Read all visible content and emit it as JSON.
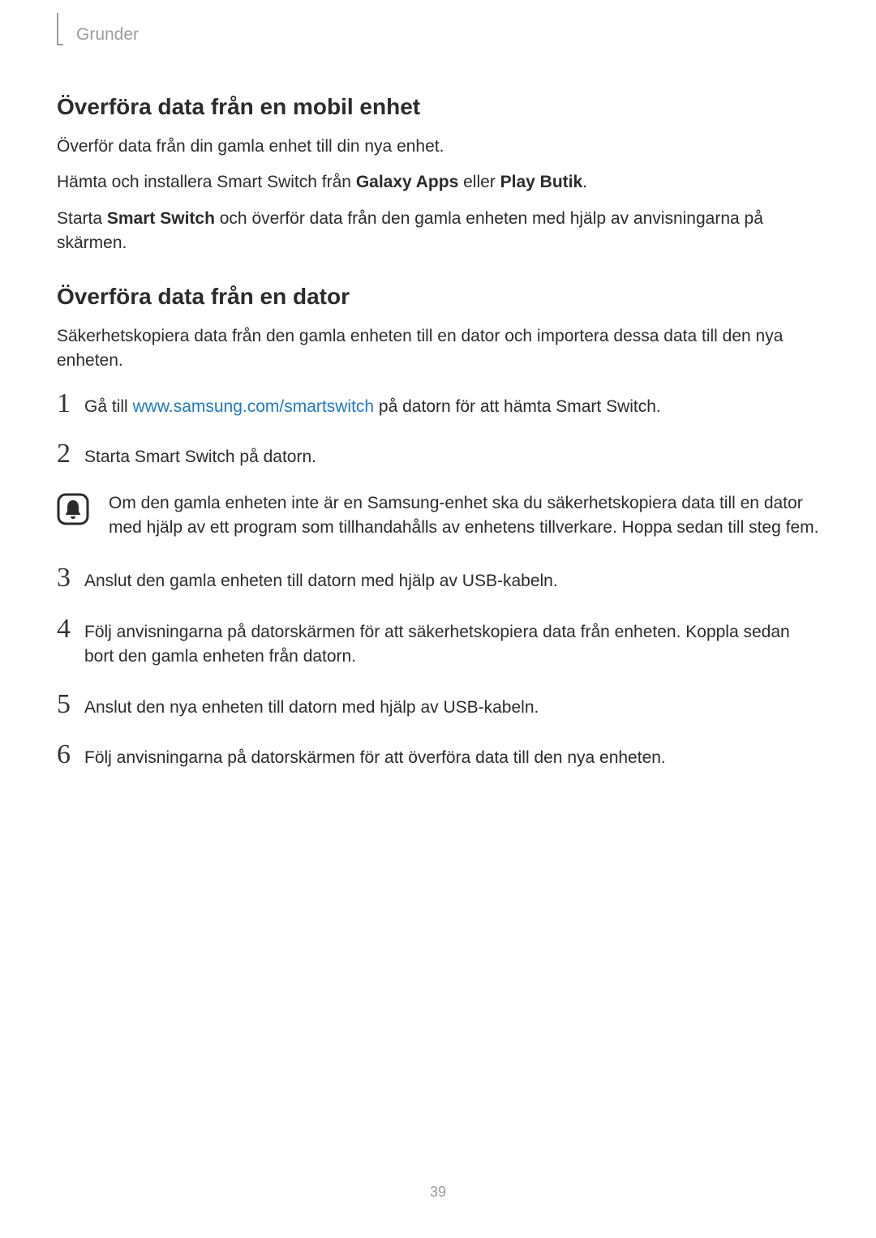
{
  "header": {
    "breadcrumb": "Grunder"
  },
  "section1": {
    "heading": "Överföra data från en mobil enhet",
    "p1": "Överför data från din gamla enhet till din nya enhet.",
    "p2_a": "Hämta och installera Smart Switch från ",
    "p2_b": "Galaxy Apps",
    "p2_c": " eller ",
    "p2_d": "Play Butik",
    "p2_e": ".",
    "p3_a": "Starta ",
    "p3_b": "Smart Switch",
    "p3_c": " och överför data från den gamla enheten med hjälp av anvisningarna på skärmen."
  },
  "section2": {
    "heading": "Överföra data från en dator",
    "intro": "Säkerhetskopiera data från den gamla enheten till en dator och importera dessa data till den nya enheten.",
    "steps": {
      "s1_a": "Gå till ",
      "s1_link": "www.samsung.com/smartswitch",
      "s1_b": " på datorn för att hämta Smart Switch.",
      "s2": "Starta Smart Switch på datorn.",
      "note": "Om den gamla enheten inte är en Samsung-enhet ska du säkerhetskopiera data till en dator med hjälp av ett program som tillhandahålls av enhetens tillverkare. Hoppa sedan till steg fem.",
      "s3": "Anslut den gamla enheten till datorn med hjälp av USB-kabeln.",
      "s4": "Följ anvisningarna på datorskärmen för att säkerhetskopiera data från enheten. Koppla sedan bort den gamla enheten från datorn.",
      "s5": "Anslut den nya enheten till datorn med hjälp av USB-kabeln.",
      "s6": "Följ anvisningarna på datorskärmen för att överföra data till den nya enheten."
    },
    "numbers": {
      "n1": "1",
      "n2": "2",
      "n3": "3",
      "n4": "4",
      "n5": "5",
      "n6": "6"
    }
  },
  "page_number": "39",
  "link_url": "www.samsung.com/smartswitch"
}
